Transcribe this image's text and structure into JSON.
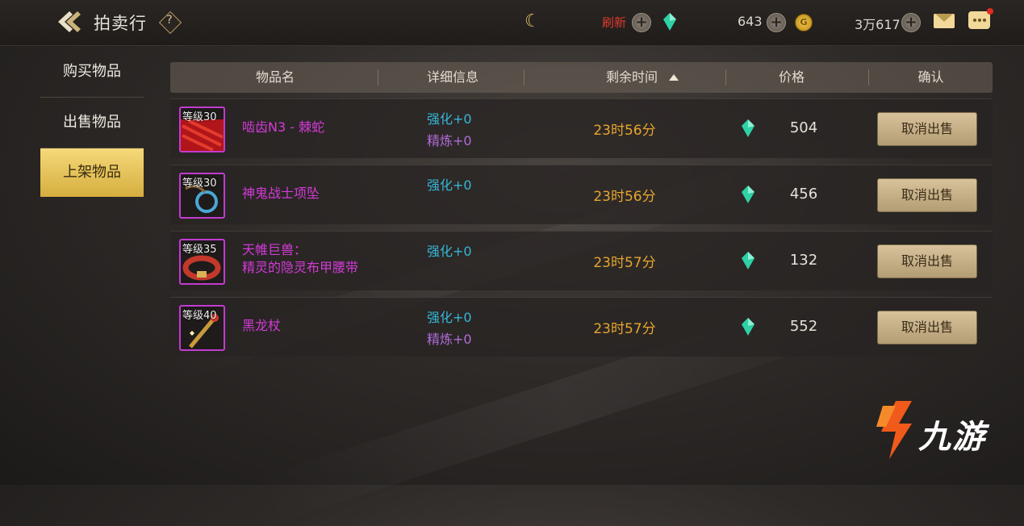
{
  "header": {
    "title": "拍卖行",
    "help_label": "?",
    "refresh_label": "刷新",
    "silver_amount": "643",
    "gold_amount": "3万617"
  },
  "sidebar": {
    "items": [
      {
        "label": "购买物品",
        "active": false
      },
      {
        "label": "出售物品",
        "active": false
      },
      {
        "label": "上架物品",
        "active": true
      }
    ]
  },
  "table": {
    "columns": [
      "物品名",
      "详细信息",
      "剩余时间",
      "价格",
      "确认"
    ],
    "rows": [
      {
        "level": "等级30",
        "name": "啮齿N3 - 棘蛇",
        "enhance": "强化+0",
        "refine": "精炼+0",
        "time": "23时56分",
        "price": "504",
        "action": "取消出售"
      },
      {
        "level": "等级30",
        "name": "神鬼战士项坠",
        "enhance": "强化+0",
        "refine": "",
        "time": "23时56分",
        "price": "456",
        "action": "取消出售"
      },
      {
        "level": "等级35",
        "name_line1": "天帷巨兽：",
        "name_line2": "精灵的隐灵布甲腰带",
        "enhance": "强化+0",
        "refine": "",
        "time": "23时57分",
        "price": "132",
        "action": "取消出售"
      },
      {
        "level": "等级40",
        "name": "黑龙杖",
        "enhance": "强化+0",
        "refine": "精炼+0",
        "time": "23时57分",
        "price": "552",
        "action": "取消出售"
      }
    ]
  },
  "watermark": {
    "text": "九游"
  },
  "colors": {
    "accent_gold": "#e7a52d",
    "item_purple": "#d33ad8",
    "enhance_cyan": "#35b6d8",
    "refine_violet": "#b06bd8",
    "refresh_red": "#e03a2c"
  }
}
